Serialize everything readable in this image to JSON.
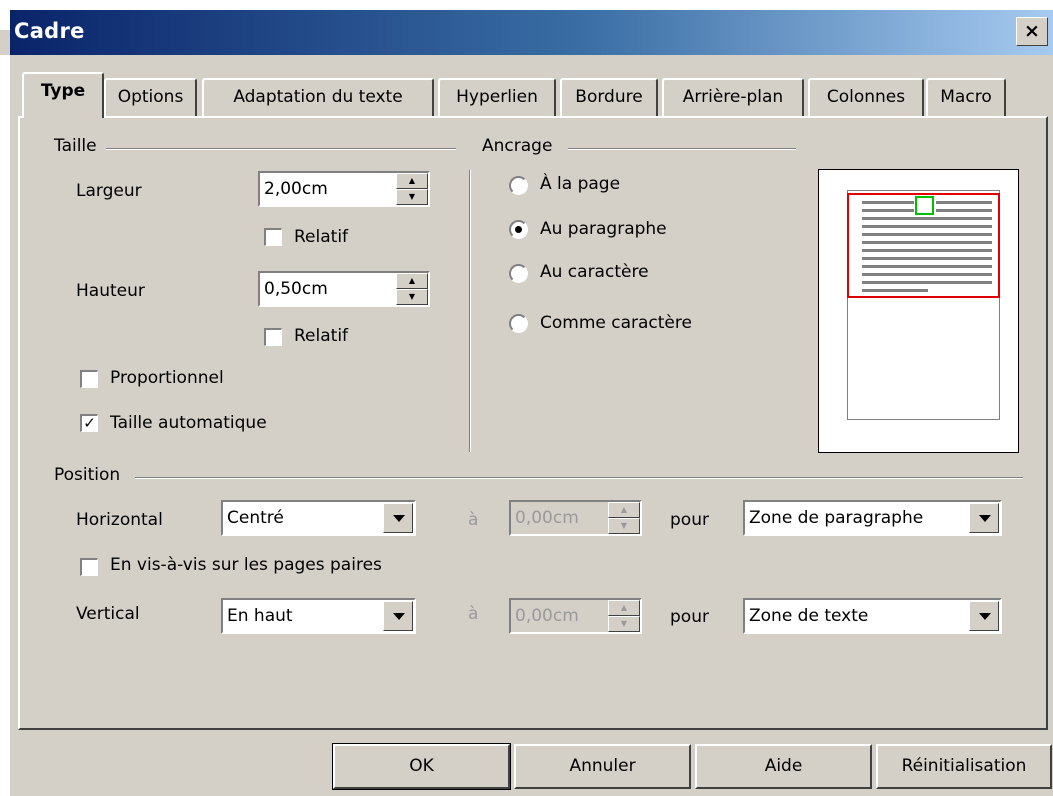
{
  "window": {
    "title": "Cadre",
    "close_symbol": "×"
  },
  "tabs": [
    {
      "label": "Type",
      "active": true
    },
    {
      "label": "Options"
    },
    {
      "label": "Adaptation du texte"
    },
    {
      "label": "Hyperlien"
    },
    {
      "label": "Bordure"
    },
    {
      "label": "Arrière-plan"
    },
    {
      "label": "Colonnes"
    },
    {
      "label": "Macro"
    }
  ],
  "taille": {
    "group_label": "Taille",
    "largeur_label": "Largeur",
    "largeur_value": "2,00cm",
    "relatif_label": "Relatif",
    "hauteur_label": "Hauteur",
    "hauteur_value": "0,50cm",
    "relatif2_label": "Relatif",
    "proportionnel_label": "Proportionnel",
    "proportionnel_checked": false,
    "auto_label": "Taille automatique",
    "auto_checked": true,
    "check_mark": "✓"
  },
  "ancrage": {
    "group_label": "Ancrage",
    "options": [
      "À la page",
      "Au paragraphe",
      "Au caractère",
      "Comme caractère"
    ],
    "selected": "Au paragraphe"
  },
  "position": {
    "group_label": "Position",
    "horizontal_label": "Horizontal",
    "horizontal_value": "Centré",
    "a_label": "à",
    "horizontal_offset": "0,00cm",
    "pour_label": "pour",
    "horizontal_pour": "Zone de paragraphe",
    "vis_a_vis_label": "En vis-à-vis sur les pages paires",
    "vertical_label": "Vertical",
    "vertical_value": "En haut",
    "vertical_offset": "0,00cm",
    "vertical_pour": "Zone de texte"
  },
  "buttons": {
    "ok": "OK",
    "cancel": "Annuler",
    "help": "Aide",
    "reset": "Réinitialisation"
  },
  "colors": {
    "title_bar_start": "#0a246a",
    "title_bar_end": "#a6caf0",
    "preview_frame": "#e00000",
    "preview_object": "#00c000"
  }
}
